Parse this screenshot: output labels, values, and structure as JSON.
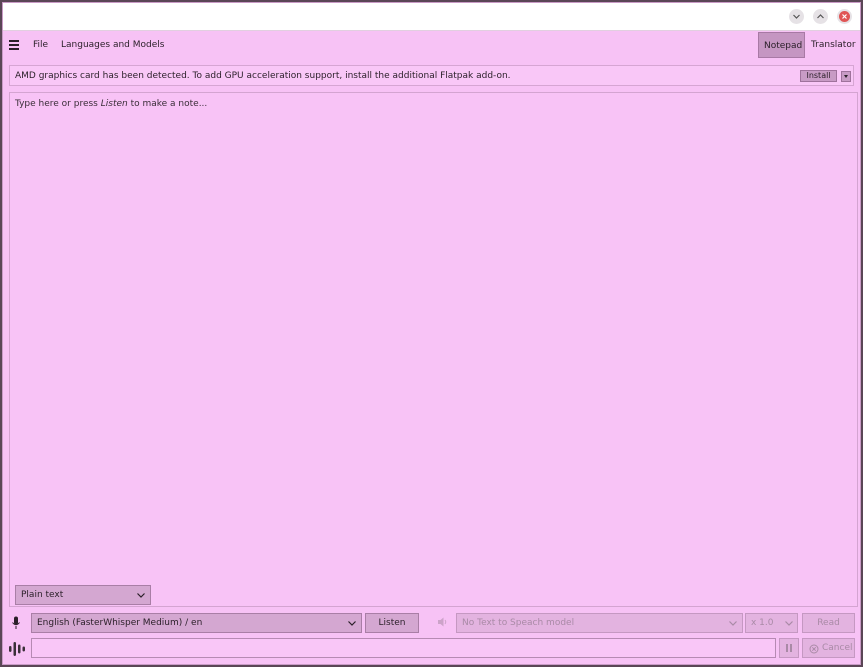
{
  "menubar": {
    "file": "File",
    "languages_models": "Languages and Models",
    "tabs": [
      {
        "label": "Notepad",
        "active": true
      },
      {
        "label": "Translator",
        "active": false
      }
    ]
  },
  "infobar": {
    "message": "AMD graphics card has been detected. To add GPU acceleration support, install the additional Flatpak add-on.",
    "install_label": "Install"
  },
  "editor": {
    "placeholder_before": "Type here or press ",
    "placeholder_em": "Listen",
    "placeholder_after": " to make a note...",
    "format": "Plain text"
  },
  "stt": {
    "model": "English (FasterWhisper Medium) / en",
    "listen_label": "Listen"
  },
  "tts": {
    "model": "No Text to Speach model",
    "speed": "x 1.0",
    "read_label": "Read"
  },
  "input": {
    "value": "",
    "cancel_label": "Cancel"
  },
  "colors": {
    "background": "#f7c2f5",
    "accent": "#c596c2",
    "disabled_text": "#a98aa6"
  }
}
